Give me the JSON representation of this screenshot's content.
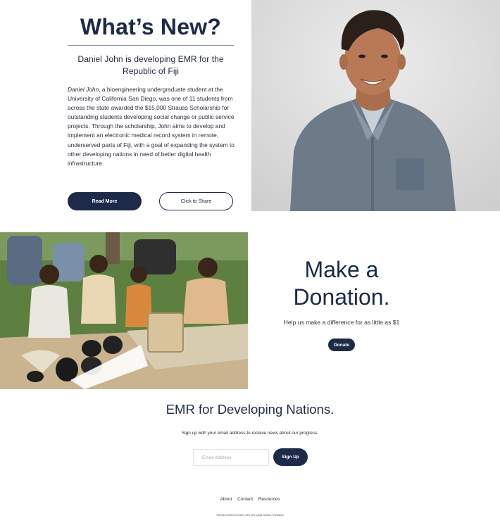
{
  "news": {
    "title": "What’s New?",
    "subhead": "Daniel John is developing EMR for the Republic of Fiji",
    "body_name": "Daniel John",
    "body_text": ", a bioengineering undergraduate student at the University of California San Diego, was one of 11 students from across the state awarded the $15,000 Strauss Scholarship for outstanding students developing social change or public service projects. Through the scholarship, John aims to develop and implement an electronic medical record system in remote, underserved parts of Fiji, with a goal of expanding the system to other developing nations in need of better digital health infrastructure.",
    "read_more_label": "Read More",
    "share_label": "Click to Share"
  },
  "donation": {
    "title_line1": "Make a",
    "title_line2": "Donation.",
    "subtitle": "Help us make a difference for as little as $1",
    "button_label": "Donate"
  },
  "newsletter": {
    "title": "EMR for Developing Nations.",
    "subtitle": "Sign up with your email address to receive news about our progress.",
    "email_placeholder": "Email Address",
    "button_label": "Sign Up"
  },
  "footer": {
    "links": [
      "About",
      "Contact",
      "Resources"
    ],
    "fine_print": "Website created by Daniel John and Cargill Strauss Foundation"
  },
  "colors": {
    "accent": "#1e2a4a",
    "text": "#2a2f3d"
  }
}
